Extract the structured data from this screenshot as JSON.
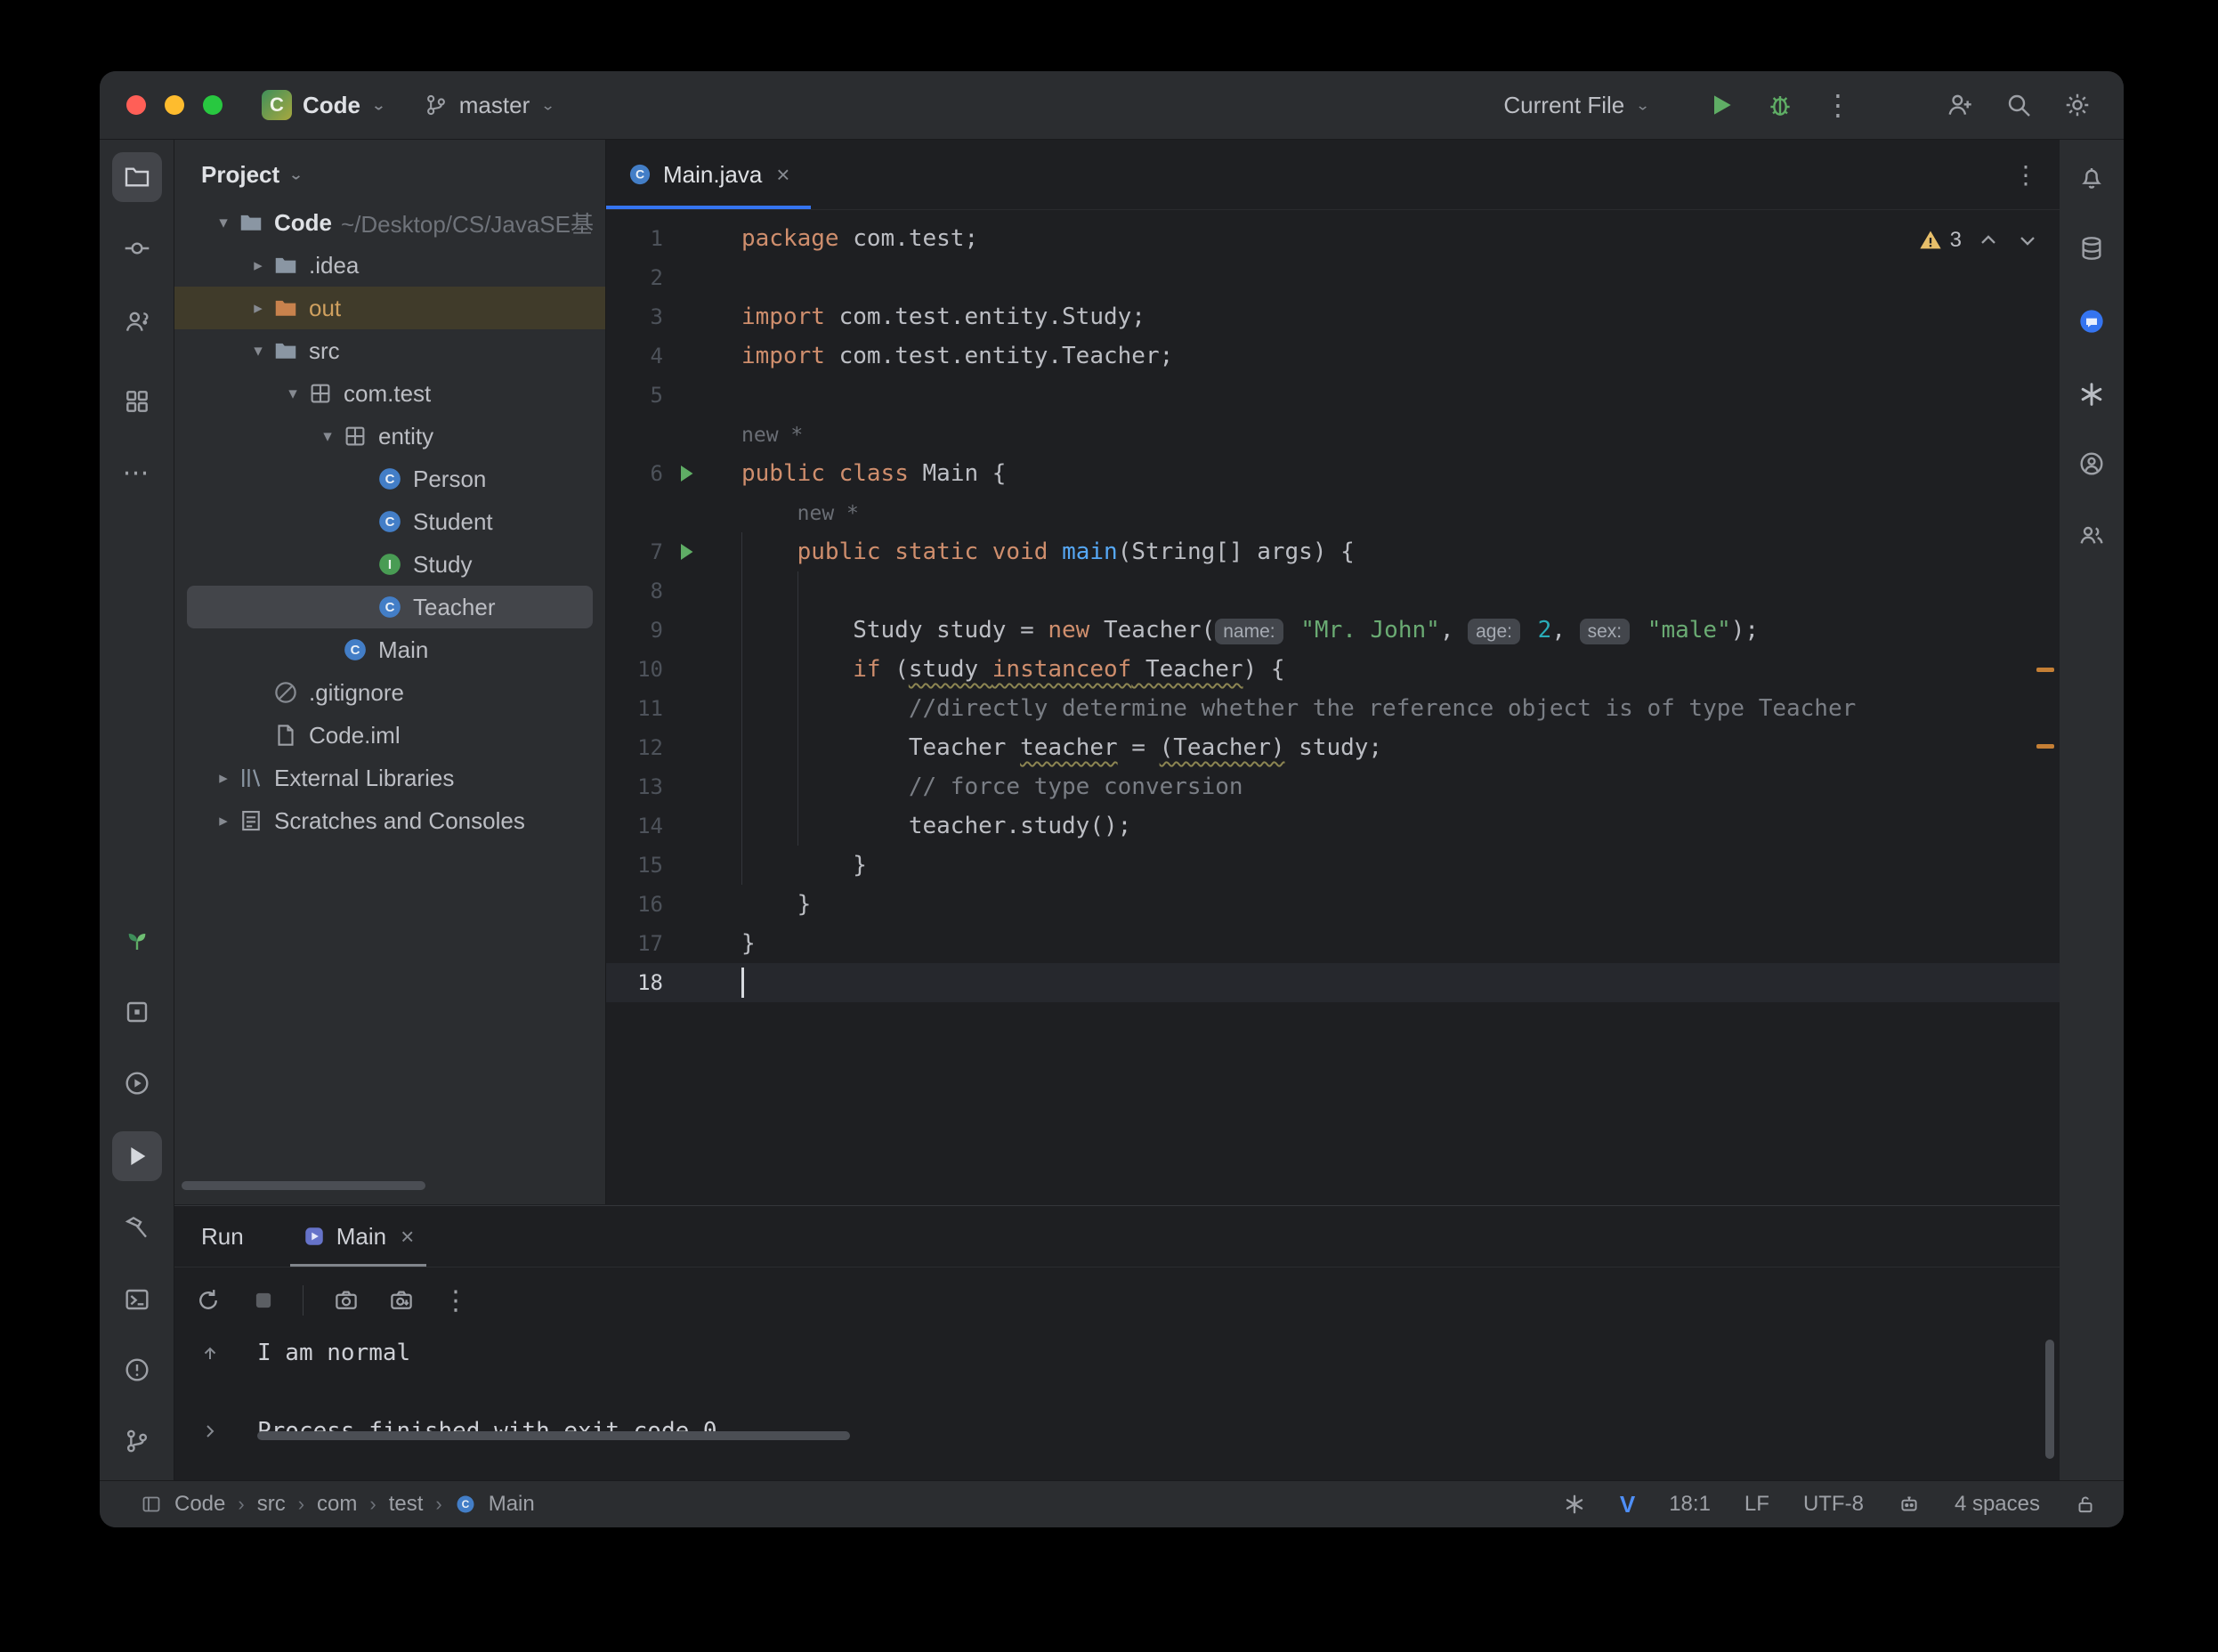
{
  "titlebar": {
    "project_name": "Code",
    "project_initial": "C",
    "branch": "master",
    "run_config": "Current File"
  },
  "project_panel": {
    "header": "Project",
    "tree": [
      {
        "label": "Code",
        "suffix": "~/Desktop/CS/JavaSE基",
        "level": 0,
        "chevron": "open",
        "icon": "folder",
        "bold": true
      },
      {
        "label": ".idea",
        "level": 1,
        "chevron": "closed",
        "icon": "folder"
      },
      {
        "label": "out",
        "level": 1,
        "chevron": "closed",
        "icon": "folder_excluded",
        "state": "excluded"
      },
      {
        "label": "src",
        "level": 1,
        "chevron": "open",
        "icon": "folder"
      },
      {
        "label": "com.test",
        "level": 2,
        "chevron": "open",
        "icon": "package"
      },
      {
        "label": "entity",
        "level": 3,
        "chevron": "open",
        "icon": "package"
      },
      {
        "label": "Person",
        "level": 4,
        "icon": "class"
      },
      {
        "label": "Student",
        "level": 4,
        "icon": "class"
      },
      {
        "label": "Study",
        "level": 4,
        "icon": "interface"
      },
      {
        "label": "Teacher",
        "level": 4,
        "icon": "class",
        "state": "selected"
      },
      {
        "label": "Main",
        "level": 3,
        "icon": "class"
      },
      {
        "label": ".gitignore",
        "level": 1,
        "icon": "ignored"
      },
      {
        "label": "Code.iml",
        "level": 1,
        "icon": "file"
      },
      {
        "label": "External Libraries",
        "level": 0,
        "chevron": "closed",
        "icon": "libraries"
      },
      {
        "label": "Scratches and Consoles",
        "level": 0,
        "chevron": "closed",
        "icon": "scratches"
      }
    ]
  },
  "editor": {
    "tab_title": "Main.java",
    "inspections_count": "3",
    "lines": [
      {
        "n": "1",
        "seg": [
          {
            "t": "package",
            "c": "kw"
          },
          {
            "t": " com.test;",
            "c": "def"
          }
        ]
      },
      {
        "n": "2",
        "seg": []
      },
      {
        "n": "3",
        "seg": [
          {
            "t": "import",
            "c": "kw"
          },
          {
            "t": " com.test.entity.Study;",
            "c": "def"
          }
        ]
      },
      {
        "n": "4",
        "seg": [
          {
            "t": "import",
            "c": "kw"
          },
          {
            "t": " com.test.entity.Teacher;",
            "c": "def"
          }
        ]
      },
      {
        "n": "5",
        "seg": []
      },
      {
        "n": "",
        "seg": [
          {
            "t": "new *",
            "c": "inlay"
          }
        ]
      },
      {
        "n": "6",
        "run": true,
        "seg": [
          {
            "t": "public",
            "c": "kw"
          },
          {
            "t": " ",
            "c": "def"
          },
          {
            "t": "class",
            "c": "kw"
          },
          {
            "t": " Main {",
            "c": "def"
          }
        ]
      },
      {
        "n": "",
        "seg": [
          {
            "t": "    ",
            "c": "def"
          },
          {
            "t": "new *",
            "c": "inlay"
          }
        ]
      },
      {
        "n": "7",
        "run": true,
        "seg": [
          {
            "t": "    ",
            "c": "def"
          },
          {
            "t": "public",
            "c": "kw"
          },
          {
            "t": " ",
            "c": "def"
          },
          {
            "t": "static",
            "c": "kw"
          },
          {
            "t": " ",
            "c": "def"
          },
          {
            "t": "void",
            "c": "kw"
          },
          {
            "t": " ",
            "c": "def"
          },
          {
            "t": "main",
            "c": "mth"
          },
          {
            "t": "(String[] args) {",
            "c": "def"
          }
        ]
      },
      {
        "n": "8",
        "seg": []
      },
      {
        "n": "9",
        "seg": [
          {
            "t": "        Study study = ",
            "c": "def"
          },
          {
            "t": "new",
            "c": "kw"
          },
          {
            "t": " Teacher(",
            "c": "def"
          },
          {
            "t": "name:",
            "c": "hint"
          },
          {
            "t": " ",
            "c": "def"
          },
          {
            "t": "\"Mr. John\"",
            "c": "str"
          },
          {
            "t": ", ",
            "c": "def"
          },
          {
            "t": "age:",
            "c": "hint"
          },
          {
            "t": " ",
            "c": "def"
          },
          {
            "t": "2",
            "c": "num"
          },
          {
            "t": ", ",
            "c": "def"
          },
          {
            "t": "sex:",
            "c": "hint"
          },
          {
            "t": " ",
            "c": "def"
          },
          {
            "t": "\"male\"",
            "c": "str"
          },
          {
            "t": ");",
            "c": "def"
          }
        ]
      },
      {
        "n": "10",
        "seg": [
          {
            "t": "        ",
            "c": "def"
          },
          {
            "t": "if",
            "c": "kw"
          },
          {
            "t": " (",
            "c": "def"
          },
          {
            "t": "study ",
            "c": "def u"
          },
          {
            "t": "instanceof",
            "c": "kw u"
          },
          {
            "t": " Teacher",
            "c": "def u"
          },
          {
            "t": ") {",
            "c": "def"
          }
        ]
      },
      {
        "n": "11",
        "seg": [
          {
            "t": "            ",
            "c": "def"
          },
          {
            "t": "//directly determine whether the reference object is of type Teacher",
            "c": "cmt"
          }
        ]
      },
      {
        "n": "12",
        "seg": [
          {
            "t": "            Teacher ",
            "c": "def"
          },
          {
            "t": "teacher",
            "c": "def u"
          },
          {
            "t": " = ",
            "c": "def"
          },
          {
            "t": "(Teacher)",
            "c": "def u"
          },
          {
            "t": " study;",
            "c": "def"
          }
        ]
      },
      {
        "n": "13",
        "seg": [
          {
            "t": "            ",
            "c": "def"
          },
          {
            "t": "// force type conversion",
            "c": "cmt"
          }
        ]
      },
      {
        "n": "14",
        "seg": [
          {
            "t": "            teacher.study();",
            "c": "def"
          }
        ]
      },
      {
        "n": "15",
        "seg": [
          {
            "t": "        }",
            "c": "def"
          }
        ]
      },
      {
        "n": "16",
        "seg": [
          {
            "t": "    }",
            "c": "def"
          }
        ]
      },
      {
        "n": "17",
        "seg": [
          {
            "t": "}",
            "c": "def"
          }
        ]
      },
      {
        "n": "18",
        "current": true,
        "seg": []
      }
    ]
  },
  "run_panel": {
    "title": "Run",
    "tab": "Main",
    "console": [
      "I am normal",
      "",
      "Process finished with exit code 0"
    ]
  },
  "status_bar": {
    "breadcrumbs": [
      "Code",
      "src",
      "com",
      "test",
      "Main"
    ],
    "caret": "18:1",
    "line_separator": "LF",
    "encoding": "UTF-8",
    "indent": "4 spaces"
  },
  "icons": {
    "titlebar": [
      "project-icon",
      "branch-icon",
      "run-icon",
      "debug-icon",
      "more-icon",
      "add-user-icon",
      "search-icon",
      "settings-icon"
    ],
    "left_stripe": [
      "project-folder-icon",
      "commit-icon",
      "code-with-me-icon",
      "structure-icon",
      "more-icon",
      "sprout-plugin-icon",
      "bookmarks-icon",
      "services-icon",
      "run-toolwindow-icon",
      "build-icon",
      "terminal-icon",
      "problems-icon",
      "version-control-icon"
    ],
    "right_stripe": [
      "notifications-icon",
      "database-icon",
      "ai-chat-icon",
      "openai-icon",
      "assistant-icon",
      "users-icon"
    ],
    "status_bar": [
      "tool-window-widget-icon",
      "openai-icon",
      "v-plugin-icon",
      "robot-icon",
      "lock-icon"
    ]
  },
  "colors": {
    "accent": "#3574f0",
    "editor_bg": "#1e1f22",
    "panel_bg": "#2b2d30",
    "keyword": "#cf8e6d",
    "string": "#6aab73",
    "number": "#2aacb8",
    "comment": "#7a7e85",
    "method": "#56a8f5",
    "warning_stripe": "#c57f35",
    "run_green": "#5fad65",
    "excluded_row_bg": "#403b2a",
    "selection_bg": "#43454a"
  }
}
